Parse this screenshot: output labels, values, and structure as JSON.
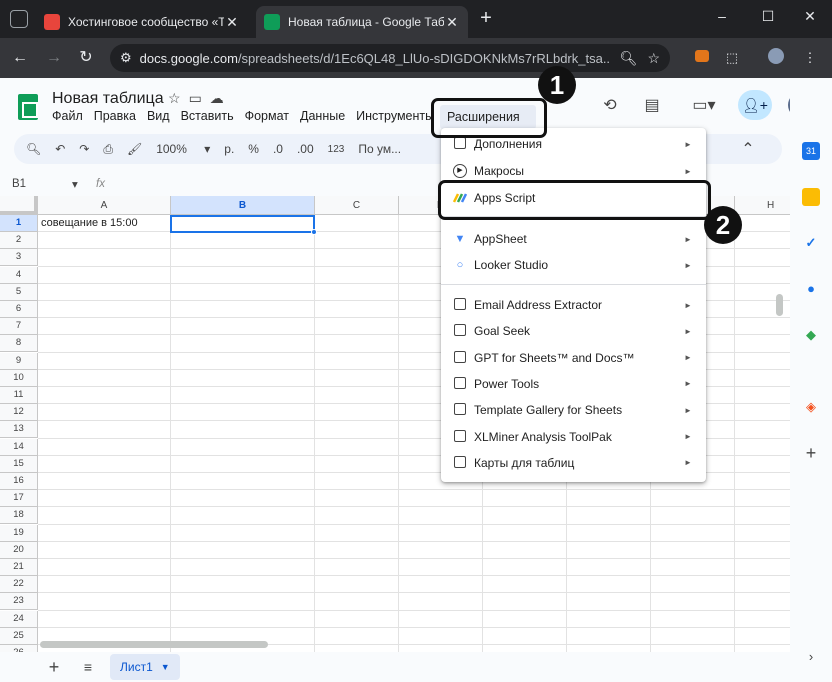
{
  "browser": {
    "tabs": [
      {
        "title": "Хостинговое сообщество «Tim",
        "favicon_color": "#e8453c"
      },
      {
        "title": "Новая таблица - Google Табли",
        "favicon_color": "#0f9d58"
      }
    ],
    "new_tab": "+",
    "window_controls": {
      "minimize": "–",
      "maximize": "☐",
      "close": "✕"
    },
    "address": {
      "host": "docs.google.com",
      "path": "/spreadsheets/d/1Ec6QL48_LlUo-sDIGDOKNkMs7rRLbdrk_tsa..."
    }
  },
  "doc": {
    "title": "Новая таблица",
    "menu": [
      "Файл",
      "Правка",
      "Вид",
      "Вставить",
      "Формат",
      "Данные",
      "Инструменты"
    ],
    "active_menu": "Расширения",
    "active_menu_more": "..."
  },
  "toolbar": {
    "zoom": "100%",
    "currency": "р.",
    "percent": "%",
    "dec_dec": ".0",
    "dec_inc": ".00",
    "number_format": "123",
    "font": "По ум..."
  },
  "formula_bar": {
    "name_box": "B1",
    "fx": "fx"
  },
  "grid": {
    "columns": [
      "A",
      "B",
      "C",
      "D",
      "E",
      "F",
      "G",
      "H"
    ],
    "rows": [
      "1",
      "2",
      "3",
      "4",
      "5",
      "6",
      "7",
      "8",
      "9",
      "10",
      "11",
      "12",
      "13",
      "14",
      "15",
      "16",
      "17",
      "18",
      "19",
      "20",
      "21",
      "22",
      "23",
      "24",
      "25",
      "26"
    ],
    "cell_A1": "совещание в 15:00",
    "selected_cell": "B1"
  },
  "sheet": {
    "add": "+",
    "list": "≡",
    "tab_name": "Лист1"
  },
  "extensions_menu": {
    "items_top": [
      {
        "label": "Дополнения",
        "icon": "addon-icon",
        "arrow": "►"
      },
      {
        "label": "Макросы",
        "icon": "macro-icon",
        "arrow": "►"
      },
      {
        "label": "Apps Script",
        "icon": "apps-script-icon",
        "arrow": ""
      }
    ],
    "items_mid": [
      {
        "label": "AppSheet",
        "icon": "appsheet-icon",
        "arrow": "►"
      },
      {
        "label": "Looker Studio",
        "icon": "looker-icon",
        "arrow": "►"
      }
    ],
    "items_addons": [
      {
        "label": "Email Address Extractor",
        "arrow": "►"
      },
      {
        "label": "Goal Seek",
        "arrow": "►"
      },
      {
        "label": "GPT for Sheets™ and Docs™",
        "arrow": "►"
      },
      {
        "label": "Power Tools",
        "arrow": "►"
      },
      {
        "label": "Template Gallery for Sheets",
        "arrow": "►"
      },
      {
        "label": "XLMiner Analysis ToolPak",
        "arrow": "►"
      },
      {
        "label": "Карты для таблиц",
        "arrow": "►"
      }
    ]
  },
  "callouts": {
    "step1": "1",
    "step2": "2"
  }
}
